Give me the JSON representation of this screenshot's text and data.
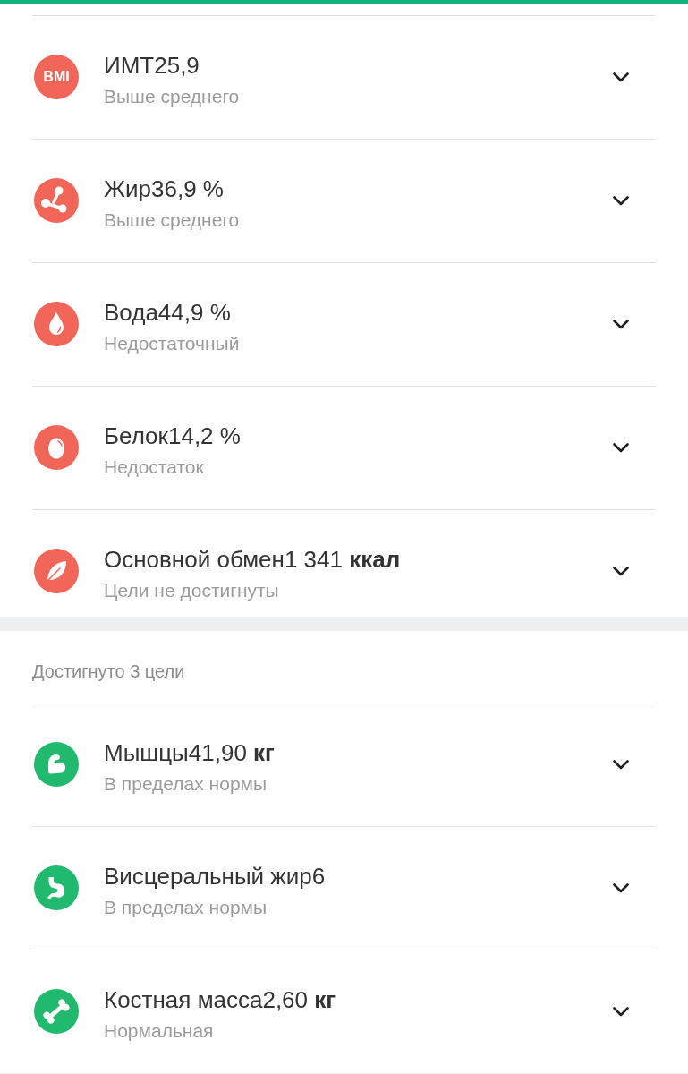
{
  "groups": [
    {
      "items": [
        {
          "kind": "bmi",
          "icon_text": "BMI",
          "title": "ИМТ25,9",
          "status": "Выше среднего",
          "color": "#f2665a",
          "expanded": false
        },
        {
          "kind": "fat",
          "title": "Жир36,9 %",
          "status": "Выше среднего",
          "color": "#f2665a",
          "expanded": false
        },
        {
          "kind": "water",
          "title": "Вода44,9 %",
          "status": "Недостаточный",
          "color": "#f2665a",
          "expanded": false
        },
        {
          "kind": "protein",
          "title": "Белок14,2 %",
          "status": "Недостаток",
          "color": "#f2665a",
          "expanded": false
        },
        {
          "kind": "metabolism",
          "title": "Основной обмен1 341 **ккал**",
          "status": "Цели не достигнуты",
          "color": "#f2665a",
          "expanded": false
        }
      ]
    },
    {
      "heading": "Достигнуто 3 цели",
      "items": [
        {
          "kind": "muscle",
          "title": "Мышцы41,90 **кг**",
          "status": "В пределах нормы",
          "color": "#21b96d",
          "expanded": false
        },
        {
          "kind": "visceral",
          "title": "Висцеральный жир6",
          "status": "В пределах нормы",
          "color": "#21b96d",
          "expanded": false
        },
        {
          "kind": "bone",
          "title": "Костная масса2,60 **кг**",
          "status": "Нормальная",
          "color": "#21b96d",
          "expanded": false
        }
      ]
    }
  ]
}
